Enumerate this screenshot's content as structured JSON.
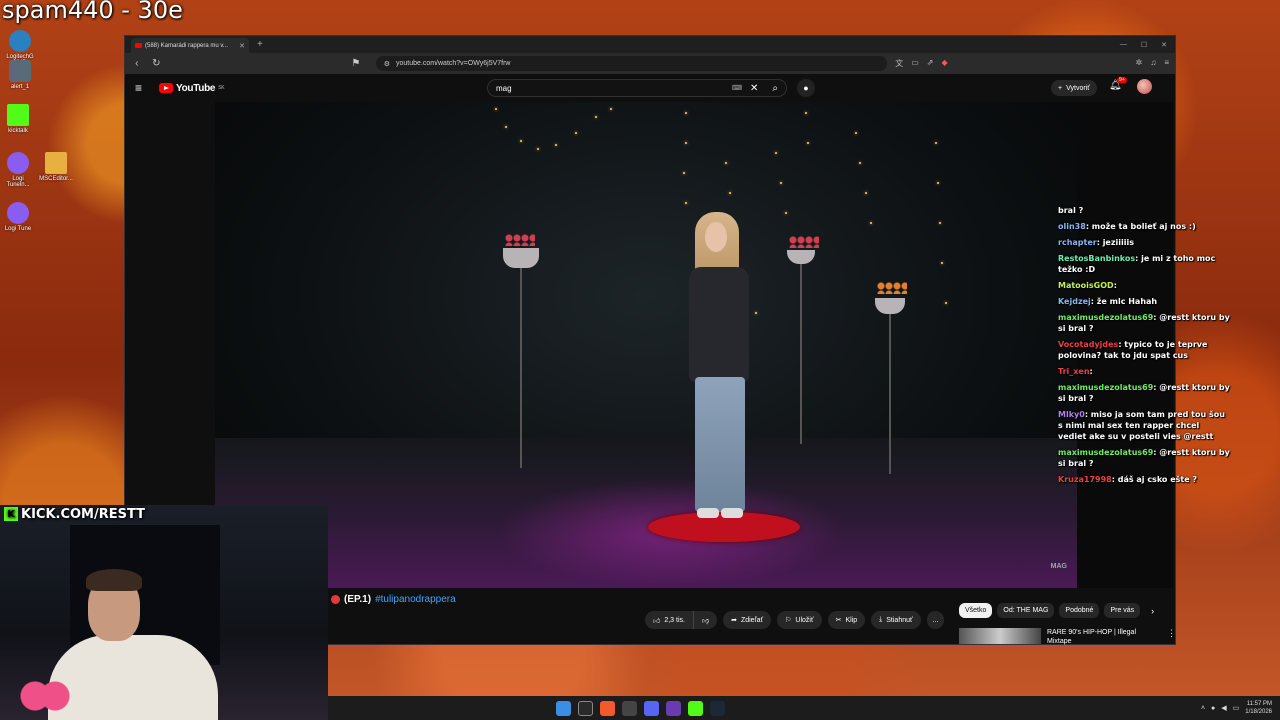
{
  "overlay": {
    "stream_title": "spam440 - 30e",
    "kick_url": "KICK.COM/RESTT"
  },
  "desktop_icons": [
    {
      "label": "LogitechG HUB",
      "color": "#2a80c0"
    },
    {
      "label": "alert_1",
      "color": "#5a6a7a"
    },
    {
      "label": "kicktalk",
      "color": "#53fc18"
    },
    {
      "label": "Logi Tuneln...",
      "color": "#8a5cf0"
    },
    {
      "label": "MSCEditor...",
      "color": "#e8b040"
    },
    {
      "label": "Logi Tune",
      "color": "#8a5cf0"
    }
  ],
  "browser": {
    "tab_title": "(588) Kamarádi rappera mu v...",
    "url": "youtube.com/watch?v=OWy6j5V7frw"
  },
  "youtube": {
    "logo_text": "YouTube",
    "logo_sup": "SK",
    "search_value": "mag",
    "create_label": "Vytvoriť",
    "notif_count": "9+",
    "video_watermark": "MAG",
    "title_prefix": "(EP.1)",
    "title_hashtag": "#tulipanodrappera",
    "actions": {
      "like": "2,3 tis.",
      "share": "Zdieľať",
      "save": "Uložiť",
      "clip": "Klip",
      "download": "Stiahnuť",
      "more": "..."
    },
    "chips": [
      "Všetko",
      "Od: THE MAG",
      "Podobné",
      "Pre vás"
    ],
    "recommendation": "RARE 90's HIP-HOP | Illegal Mixtape"
  },
  "chat": [
    {
      "user": "",
      "text": "bral ?",
      "color": "#ffffff"
    },
    {
      "user": "olin38",
      "text": "može ta bolieť aj nos :)",
      "color": "#8ab4f8"
    },
    {
      "user": "rchapter",
      "text": "jeziiiiis",
      "color": "#8ab4f8"
    },
    {
      "user": "RestosBanbinkos",
      "text": "je mi z toho moc težko :D",
      "color": "#6cf0b0"
    },
    {
      "user": "MatooisGOD",
      "text": "",
      "color": "#c0f060"
    },
    {
      "user": "Kejdzej",
      "text": "že mlc Hahah",
      "color": "#8ab4f8"
    },
    {
      "user": "maximusdezolatus69",
      "text": "@restt ktoru by si bral ?",
      "color": "#6cf060"
    },
    {
      "user": "Vocotadyjdes",
      "text": "typico to je teprve polovina? tak to jdu spat cus",
      "color": "#f04040"
    },
    {
      "user": "Tri_xen",
      "text": "",
      "color": "#f04040"
    },
    {
      "user": "maximusdezolatus69",
      "text": "@restt ktoru by si bral ?",
      "color": "#6cf060"
    },
    {
      "user": "Mlky0",
      "text": "miso ja som tam pred tou šou s nimi mal sex ten rapper chcel vediet ake su v posteli vies @restt",
      "color": "#b080f0"
    },
    {
      "user": "maximusdezolatus69",
      "text": "@restt ktoru by si bral ?",
      "color": "#6cf060"
    },
    {
      "user": "Kruza17998",
      "text": "dáš aj csko ešte ?",
      "color": "#f04040"
    }
  ],
  "taskbar": {
    "time": "11:57 PM",
    "date": "1/18/2026"
  }
}
